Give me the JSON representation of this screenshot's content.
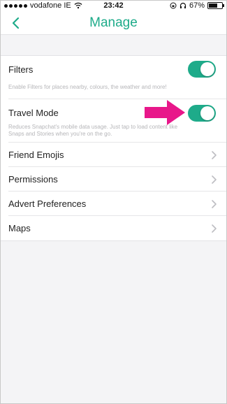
{
  "status_bar": {
    "carrier": "vodafone IE",
    "time": "23:42",
    "battery_percent": "67%",
    "battery_level": 0.67
  },
  "header": {
    "title": "Manage"
  },
  "settings": {
    "filters": {
      "label": "Filters",
      "description": "Enable Filters for places nearby, colours, the weather and more!",
      "enabled": true
    },
    "travel_mode": {
      "label": "Travel Mode",
      "description": "Reduces Snapchat's mobile data usage. Just tap to load content like Snaps and Stories when you're on the go.",
      "enabled": true
    },
    "links": [
      {
        "label": "Friend Emojis"
      },
      {
        "label": "Permissions"
      },
      {
        "label": "Advert Preferences"
      },
      {
        "label": "Maps"
      }
    ]
  },
  "colors": {
    "accent": "#1eab8a",
    "annotation_arrow": "#e8178a"
  }
}
